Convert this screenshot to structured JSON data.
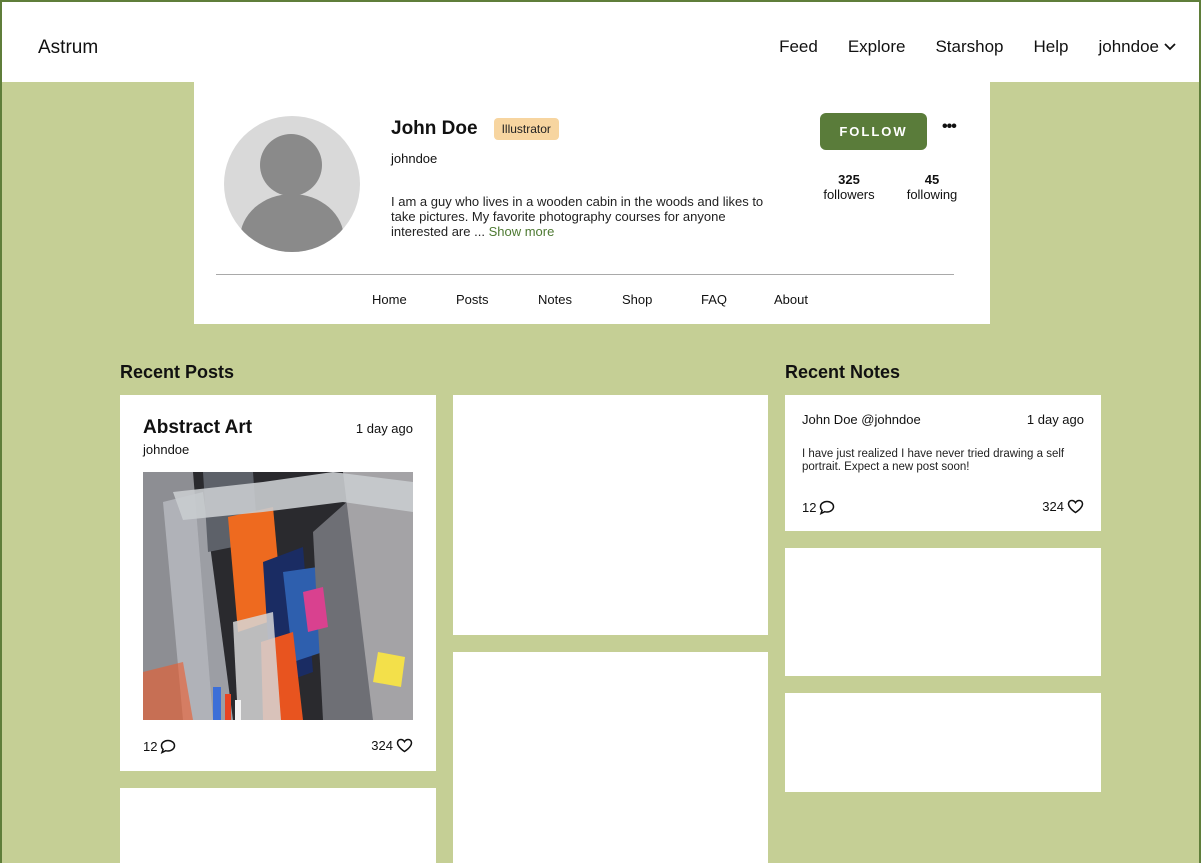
{
  "header": {
    "brand": "Astrum",
    "nav": [
      "Feed",
      "Explore",
      "Starshop",
      "Help"
    ],
    "user_menu": "johndoe"
  },
  "profile": {
    "name": "John Doe",
    "badge": "Illustrator",
    "username": "johndoe",
    "bio": "I am a guy who lives in a wooden cabin in the woods and likes to take pictures. My favorite photography courses for anyone interested are ... ",
    "show_more": "Show more",
    "follow_label": "FOLLOW",
    "more_label": "•••",
    "followers_count": "325",
    "followers_label": "followers",
    "following_count": "45",
    "following_label": "following",
    "tabs": [
      "Home",
      "Posts",
      "Notes",
      "Shop",
      "FAQ",
      "About"
    ]
  },
  "recent_posts": {
    "title": "Recent Posts",
    "post": {
      "title": "Abstract Art",
      "author": "johndoe",
      "time": "1 day ago",
      "comments": "12",
      "likes": "324"
    }
  },
  "recent_notes": {
    "title": "Recent Notes",
    "note": {
      "author": "John Doe @johndoe",
      "time": "1 day ago",
      "text": "I have just realized I have never tried drawing a self portrait. Expect a new post soon!",
      "comments": "12",
      "likes": "324"
    }
  },
  "colors": {
    "page_background": "#c5cf95",
    "accent": "#5a7c3a",
    "badge": "#f7d5a0",
    "link": "#4e7a32"
  },
  "icons": [
    "chevron-down-icon",
    "comment-icon",
    "heart-icon",
    "more-icon"
  ]
}
